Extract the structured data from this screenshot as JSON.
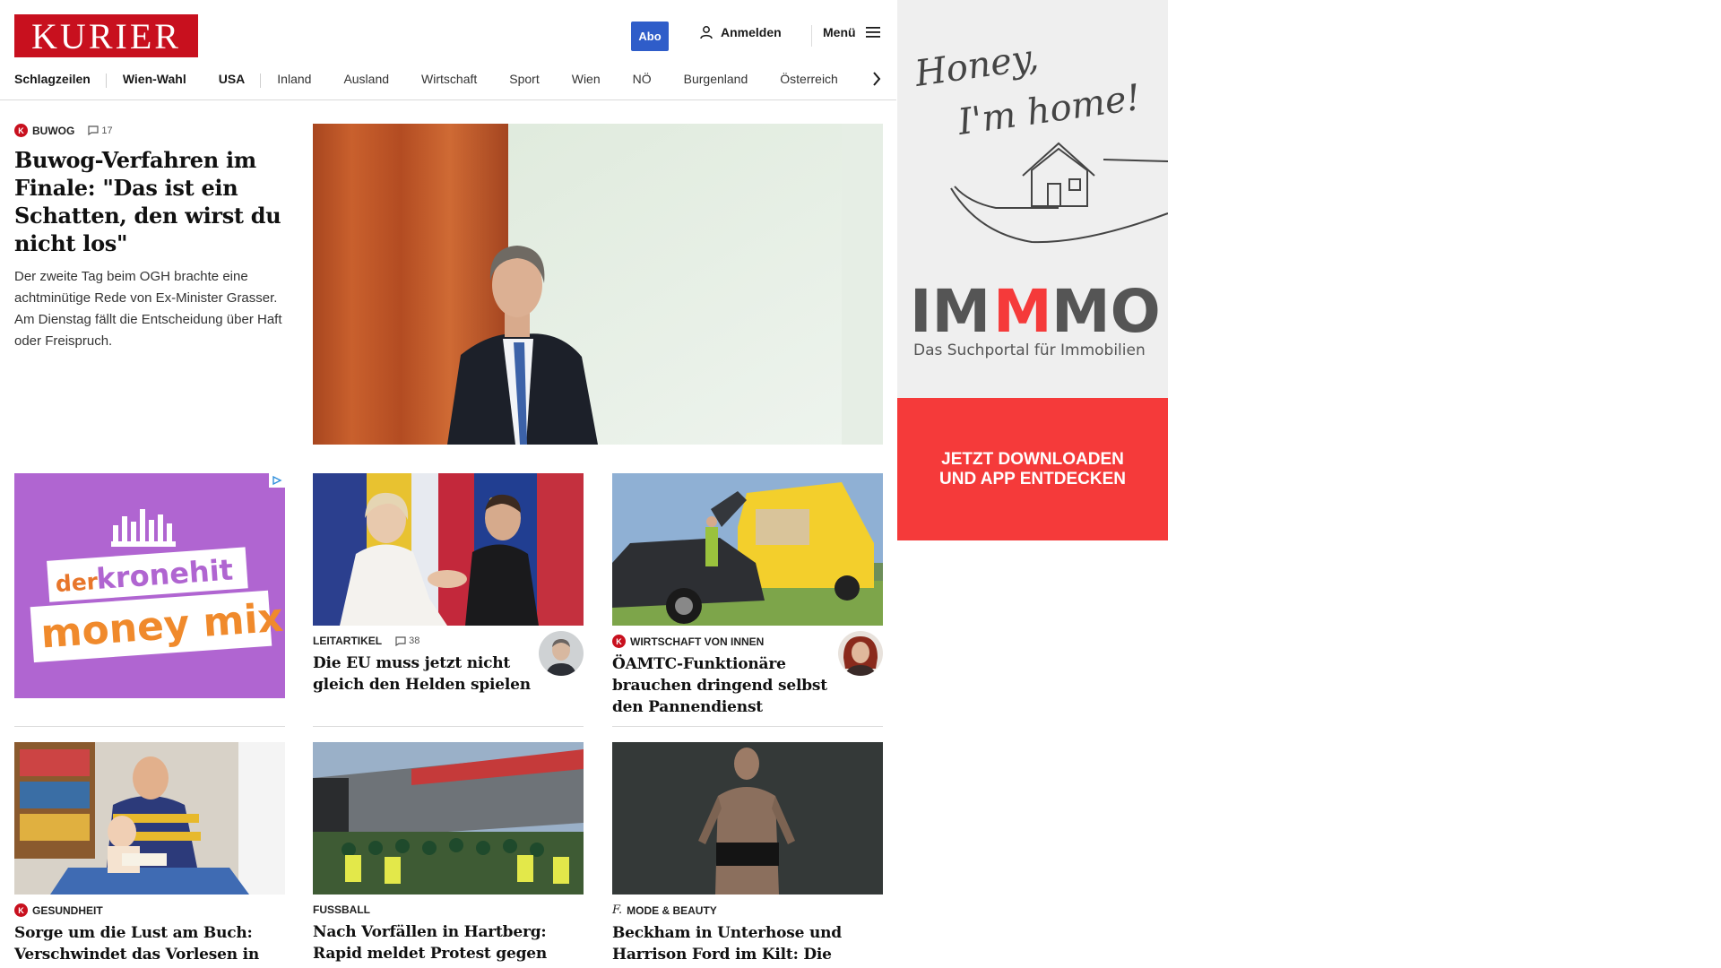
{
  "header": {
    "logo_text": "KURIER",
    "abo_label": "Abo",
    "login_label": "Anmelden",
    "menu_label": "Menü"
  },
  "nav": {
    "items": [
      "Schlagzeilen",
      "Wien-Wahl",
      "USA",
      "Inland",
      "Ausland",
      "Wirtschaft",
      "Sport",
      "Wien",
      "NÖ",
      "Burgenland",
      "Österreich"
    ]
  },
  "lead": {
    "kicker": "BUWOG",
    "comments": "17",
    "headline": "Buwog-Verfahren im Finale: \"Das ist ein Schatten, den wirst du nicht los\"",
    "teaser": "Der zweite Tag beim OGH brachte eine achtminütige Rede von Ex-Minister Grasser. Am Dienstag fällt die Entscheidung über Haft oder Freispruch."
  },
  "ad_left": {
    "line1": "der",
    "line2": "kronehit",
    "line3": "money mix"
  },
  "cards": [
    {
      "kicker": "LEITARTIKEL",
      "comments": "38",
      "headline": "Die EU muss jetzt nicht gleich den Helden spielen"
    },
    {
      "kicker": "WIRTSCHAFT VON INNEN",
      "headline": "ÖAMTC-Funktionäre brauchen dringend selbst den Pannendienst"
    },
    {
      "kicker": "GESUNDHEIT",
      "headline": "Sorge um die Lust am Buch: Verschwindet das Vorlesen in Familien?"
    },
    {
      "kicker": "FUSSBALL",
      "headline": "Nach Vorfällen in Hartberg: Rapid meldet Protest gegen Senatsbeschluss an"
    },
    {
      "kicker": "MODE & BEAUTY",
      "headline": "Beckham in Unterhose und Harrison Ford im Kilt: Die besten Werbungen"
    }
  ],
  "side_ad": {
    "script_line1": "Honey,",
    "script_line2": "I'm home!",
    "brand_a": "IM",
    "brand_b": "M",
    "brand_c": "MO",
    "tagline": "Das Suchportal für Immobilien",
    "cta_line1": "JETZT DOWNLOADEN",
    "cta_line2": "UND APP ENTDECKEN"
  },
  "colors": {
    "brand_red": "#c8101e",
    "abo_blue": "#2f5dc9",
    "ad_purple": "#b065d1",
    "cta_red": "#f53a3a"
  }
}
